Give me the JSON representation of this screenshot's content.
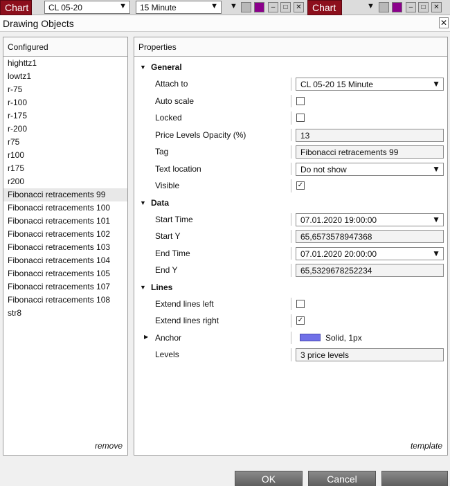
{
  "toolbar": {
    "chart_label": "Chart",
    "instrument": "CL 05-20",
    "interval": "15 Minute",
    "chart_label_2": "Chart"
  },
  "window": {
    "title": "Drawing Objects"
  },
  "configured": {
    "header": "Configured",
    "items": [
      "highttz1",
      "lowtz1",
      "r-75",
      "r-100",
      "r-175",
      "r-200",
      "r75",
      "r100",
      "r175",
      "r200",
      "Fibonacci retracements 99",
      "Fibonacci retracements 100",
      "Fibonacci retracements 101",
      "Fibonacci retracements 102",
      "Fibonacci retracements 103",
      "Fibonacci retracements 104",
      "Fibonacci retracements 105",
      "Fibonacci retracements 107",
      "Fibonacci retracements 108",
      "str8"
    ],
    "selected_index": 10,
    "remove_label": "remove"
  },
  "properties": {
    "header": "Properties",
    "template_label": "template",
    "general": {
      "label": "General",
      "attach_to_label": "Attach to",
      "attach_to_value": "CL 05-20 15 Minute",
      "auto_scale_label": "Auto scale",
      "locked_label": "Locked",
      "opacity_label": "Price Levels Opacity (%)",
      "opacity_value": "13",
      "tag_label": "Tag",
      "tag_value": "Fibonacci retracements 99",
      "text_location_label": "Text location",
      "text_location_value": "Do not show",
      "visible_label": "Visible"
    },
    "data": {
      "label": "Data",
      "start_time_label": "Start Time",
      "start_time_value": "07.01.2020 19:00:00",
      "start_y_label": "Start Y",
      "start_y_value": "65,6573578947368",
      "end_time_label": "End Time",
      "end_time_value": "07.01.2020 20:00:00",
      "end_y_label": "End Y",
      "end_y_value": "65,5329678252234"
    },
    "lines": {
      "label": "Lines",
      "extend_left_label": "Extend lines left",
      "extend_right_label": "Extend lines right",
      "anchor_label": "Anchor",
      "anchor_value": "Solid, 1px",
      "levels_label": "Levels",
      "levels_value": "3 price levels"
    }
  },
  "buttons": {
    "ok": "OK",
    "cancel": "Cancel"
  },
  "colors": {
    "chart_tab": "#8c0f1c",
    "anchor_swatch": "#7070e8",
    "swatch_purple": "#8b008b"
  }
}
